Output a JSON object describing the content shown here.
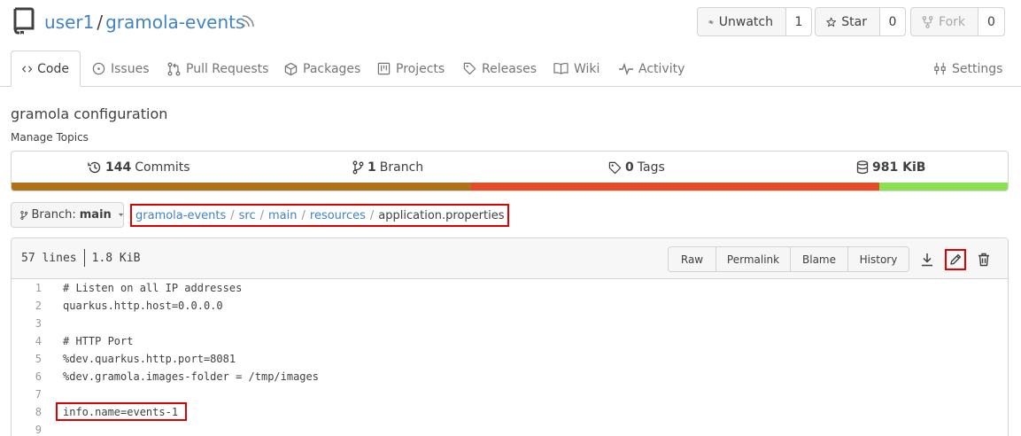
{
  "repo": {
    "owner": "user1",
    "separator": "/",
    "name": "gramola-events"
  },
  "actions": {
    "watch": {
      "label": "Unwatch",
      "count": "1"
    },
    "star": {
      "label": "Star",
      "count": "0"
    },
    "fork": {
      "label": "Fork",
      "count": "0"
    }
  },
  "tabs": [
    {
      "label": "Code",
      "icon": "code-icon"
    },
    {
      "label": "Issues",
      "icon": "issue-icon"
    },
    {
      "label": "Pull Requests",
      "icon": "pull-request-icon"
    },
    {
      "label": "Packages",
      "icon": "package-icon"
    },
    {
      "label": "Projects",
      "icon": "project-icon"
    },
    {
      "label": "Releases",
      "icon": "tag-icon"
    },
    {
      "label": "Wiki",
      "icon": "book-icon"
    },
    {
      "label": "Activity",
      "icon": "pulse-icon"
    },
    {
      "label": "Settings",
      "icon": "tools-icon"
    }
  ],
  "description": "gramola configuration",
  "manage_topics": "Manage Topics",
  "stats": {
    "commits": {
      "count": "144",
      "label": "Commits"
    },
    "branches": {
      "count": "1",
      "label": "Branch"
    },
    "tags": {
      "count": "0",
      "label": "Tags"
    },
    "size": {
      "value": "981 KiB"
    }
  },
  "language_bar": [
    {
      "color": "#b07219",
      "percent": 46.1
    },
    {
      "color": "#e34c26",
      "percent": 41.0
    },
    {
      "color": "#89e051",
      "percent": 12.9
    }
  ],
  "branch": {
    "label": "Branch:",
    "name": "main"
  },
  "breadcrumb": {
    "parts": [
      "gramola-events",
      "src",
      "main",
      "resources"
    ],
    "divider": "/",
    "current": "application.properties"
  },
  "file": {
    "lines": "57 lines",
    "size": "1.8 KiB",
    "buttons": [
      "Raw",
      "Permalink",
      "Blame",
      "History"
    ]
  },
  "code_lines": [
    {
      "n": "1",
      "text": "# Listen on all IP addresses"
    },
    {
      "n": "2",
      "text": "quarkus.http.host=0.0.0.0"
    },
    {
      "n": "3",
      "text": ""
    },
    {
      "n": "4",
      "text": "# HTTP Port"
    },
    {
      "n": "5",
      "text": "%dev.quarkus.http.port=8081"
    },
    {
      "n": "6",
      "text": "%dev.gramola.images-folder = /tmp/images"
    },
    {
      "n": "7",
      "text": ""
    },
    {
      "n": "8",
      "text": "info.name=events-1"
    },
    {
      "n": "9",
      "text": ""
    }
  ],
  "colors": {
    "link": "#4183c4",
    "highlight_box": "#e00000"
  }
}
